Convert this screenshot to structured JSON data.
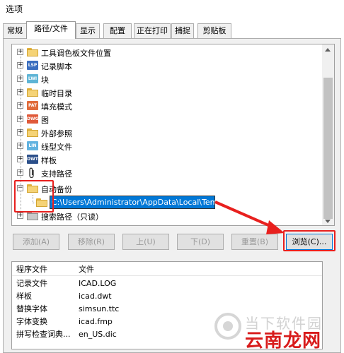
{
  "window": {
    "title": "选项"
  },
  "tabs": [
    {
      "label": "常规",
      "active": false
    },
    {
      "label": "路径/文件",
      "active": true
    },
    {
      "label": "显示",
      "active": false
    },
    {
      "label": "配置",
      "active": false
    },
    {
      "label": "正在打印",
      "active": false
    },
    {
      "label": "捕捉",
      "active": false
    },
    {
      "label": "剪贴板",
      "active": false
    }
  ],
  "tree": {
    "items": [
      {
        "label": "工具调色板文件位置",
        "icon": "folder-icon"
      },
      {
        "label": "记录脚本",
        "icon": "lsp-file-icon",
        "badge": "LSP",
        "color": "#3a6ebf"
      },
      {
        "label": "块",
        "icon": "lwi-file-icon",
        "badge": "LWI",
        "color": "#5fb5d6"
      },
      {
        "label": "临时目录",
        "icon": "folder-icon"
      },
      {
        "label": "填充模式",
        "icon": "pat-file-icon",
        "badge": "PAT",
        "color": "#e06b3a"
      },
      {
        "label": "图",
        "icon": "dwg-file-icon",
        "badge": "DWG",
        "color": "#e05a3a"
      },
      {
        "label": "外部参照",
        "icon": "folder-icon"
      },
      {
        "label": "线型文件",
        "icon": "lin-file-icon",
        "badge": "LIN",
        "color": "#62b3e0"
      },
      {
        "label": "样板",
        "icon": "dwt-file-icon",
        "badge": "DWT",
        "color": "#2b4f8a"
      },
      {
        "label": "支持路径",
        "icon": "paperclip-icon"
      },
      {
        "label": "自动备份",
        "icon": "folder-icon",
        "expanded": true
      },
      {
        "label": "搜索路径（只读）",
        "icon": "multi-folder-icon"
      }
    ],
    "child_path": "C:\\Users\\Administrator\\AppData\\Local\\Temp"
  },
  "buttons": {
    "add": "添加(A)",
    "remove": "移除(R)",
    "up": "上(U)",
    "down": "下(D)",
    "reset": "重置(B)",
    "browse": "浏览(C)..."
  },
  "files_table": {
    "headers": [
      "程序文件",
      "文件"
    ],
    "rows": [
      [
        "记录文件",
        "ICAD.LOG"
      ],
      [
        "样板",
        "icad.dwt"
      ],
      [
        "替换字体",
        "simsun.ttc"
      ],
      [
        "字体变换",
        "icad.fmp"
      ],
      [
        "拼写检查词典...",
        "en_US.dic"
      ]
    ]
  },
  "watermark": {
    "top": "当下软件园",
    "bottom": "云南龙网"
  },
  "colors": {
    "highlight": "#e8201e",
    "selection": "#0078d7"
  }
}
